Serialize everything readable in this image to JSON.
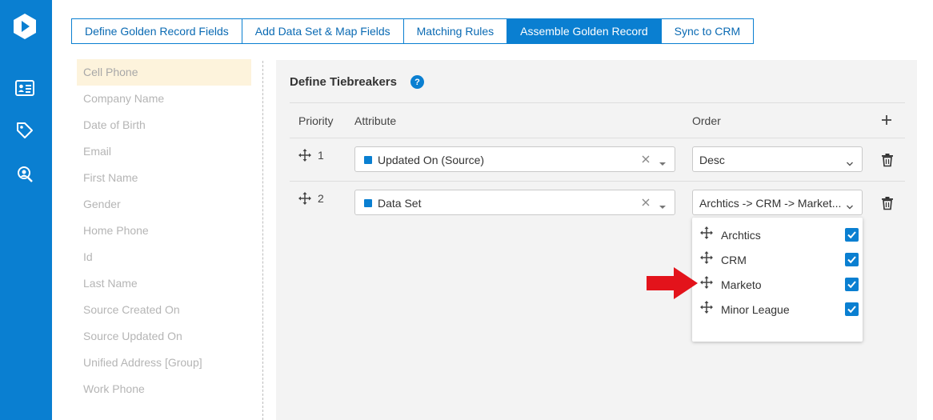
{
  "colors": {
    "accent": "#0a7fd1",
    "rail": "#0a7fd1",
    "selected_bg": "#fdf3dc",
    "panel_bg": "#f3f3f3",
    "annotation_arrow": "#e3131b"
  },
  "sidebar": {
    "icons": [
      "logo-icon",
      "contact-card-icon",
      "tag-icon",
      "user-search-icon"
    ]
  },
  "tabs": [
    {
      "label": "Define Golden Record Fields",
      "active": false
    },
    {
      "label": "Add Data Set & Map Fields",
      "active": false
    },
    {
      "label": "Matching Rules",
      "active": false
    },
    {
      "label": "Assemble Golden Record",
      "active": true
    },
    {
      "label": "Sync to CRM",
      "active": false
    }
  ],
  "fields": [
    "Cell Phone",
    "Company Name",
    "Date of Birth",
    "Email",
    "First Name",
    "Gender",
    "Home Phone",
    "Id",
    "Last Name",
    "Source Created On",
    "Source Updated On",
    "Unified Address [Group]",
    "Work Phone"
  ],
  "selected_field": "Cell Phone",
  "tiebreakers": {
    "title": "Define Tiebreakers",
    "help": "?",
    "columns": {
      "priority": "Priority",
      "attribute": "Attribute",
      "order": "Order"
    },
    "rows": [
      {
        "priority": "1",
        "attribute": "Updated On (Source)",
        "order": "Desc"
      },
      {
        "priority": "2",
        "attribute": "Data Set",
        "order": "Archtics -> CRM -> Market..."
      }
    ]
  },
  "order_dropdown": {
    "options": [
      {
        "label": "Archtics",
        "checked": true
      },
      {
        "label": "CRM",
        "checked": true
      },
      {
        "label": "Marketo",
        "checked": true
      },
      {
        "label": "Minor League",
        "checked": true
      }
    ]
  }
}
